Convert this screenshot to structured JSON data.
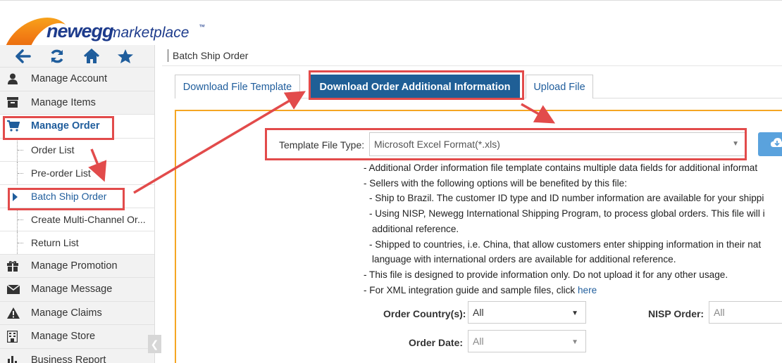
{
  "brand": {
    "name": "newegg",
    "suffix": "marketplace",
    "tm": "™"
  },
  "toolbar": {
    "icons": [
      "back-arrow-icon",
      "refresh-icon",
      "home-icon",
      "star-icon"
    ]
  },
  "sidebar": {
    "items": [
      {
        "label": "Manage Account",
        "icon": "user-icon"
      },
      {
        "label": "Manage Items",
        "icon": "archive-icon"
      },
      {
        "label": "Manage Order",
        "icon": "cart-icon",
        "active": true
      },
      {
        "label": "Manage Promotion",
        "icon": "gift-icon"
      },
      {
        "label": "Manage Message",
        "icon": "envelope-icon"
      },
      {
        "label": "Manage Claims",
        "icon": "warning-icon"
      },
      {
        "label": "Manage Store",
        "icon": "store-icon"
      },
      {
        "label": "Business Report",
        "icon": "bar-chart-icon"
      }
    ],
    "subitems": [
      {
        "label": "Order List"
      },
      {
        "label": "Pre-order List"
      },
      {
        "label": "Batch Ship Order",
        "current": true
      },
      {
        "label": "Create Multi-Channel Or..."
      },
      {
        "label": "Return List"
      }
    ]
  },
  "breadcrumb": {
    "title": "Batch Ship Order"
  },
  "tabs": [
    {
      "label": "Download File Template"
    },
    {
      "label": "Download Order Additional Information",
      "active": true
    },
    {
      "label": "Upload File"
    }
  ],
  "form": {
    "template_label": "Template File Type:",
    "template_value": "Microsoft Excel Format(*.xls)",
    "notes": [
      "- Additional Order information file template contains multiple data fields for additional informat",
      "- Sellers with the following options will be benefited by this file:",
      "- Ship to Brazil. The customer ID type and ID number information are available for your shippi",
      "- Using NISP, Newegg International Shipping Program, to process global orders. This file will i",
      "additional reference.",
      "- Shipped to countries, i.e. China, that allow customers enter shipping information in their nat",
      "language with international orders are available for additional reference.",
      "- This file is designed to provide information only. Do not upload it for any other usage.",
      "- For XML integration guide and sample files, click "
    ],
    "notes_link": "here",
    "order_country_label": "Order Country(s):",
    "order_country_value": "All",
    "nisp_label": "NISP Order:",
    "nisp_value": "All",
    "order_date_label": "Order Date:",
    "order_date_value": "All"
  },
  "colors": {
    "accent": "#1f5f96",
    "highlight": "#e24b4b",
    "panel_border": "#f5a623"
  }
}
